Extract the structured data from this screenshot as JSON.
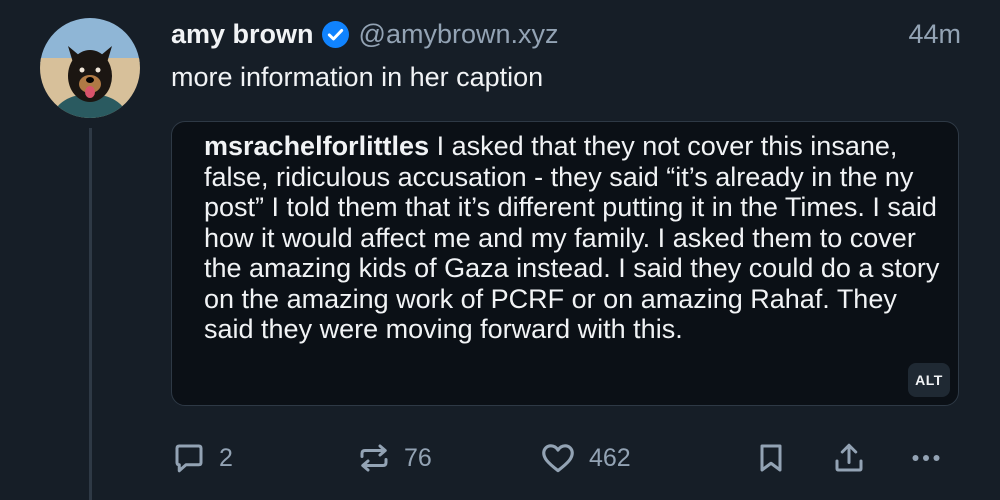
{
  "post": {
    "author": {
      "display_name": "amy brown",
      "handle": "@amybrown.xyz",
      "verified": true
    },
    "timestamp": "44m",
    "text": "more information in her caption",
    "embed": {
      "caption_username": "msrachelforlittles",
      "caption_text": "I asked that they not cover this insane, false, ridiculous accusation - they said “it’s already in the ny post” I told them that it’s different putting it in the Times. I said how it would affect me and my family. I asked them to cover the amazing kids of Gaza instead. I said they could do a story on the amazing work of PCRF or on amazing Rahaf. They said they were moving forward with this.",
      "alt_badge": "ALT"
    },
    "actions": {
      "reply": {
        "icon": "reply-icon",
        "count": "2"
      },
      "repost": {
        "icon": "repost-icon",
        "count": "76"
      },
      "like": {
        "icon": "heart-icon",
        "count": "462"
      },
      "bookmark": {
        "icon": "bookmark-icon"
      },
      "share": {
        "icon": "share-icon"
      },
      "more": {
        "icon": "more-icon"
      }
    }
  },
  "colors": {
    "background": "#161e27",
    "text_primary": "#f1f3f5",
    "text_secondary": "#93a3b4",
    "verified_badge": "#1083fe",
    "card_background": "#0b1016",
    "border": "#2e3945"
  }
}
